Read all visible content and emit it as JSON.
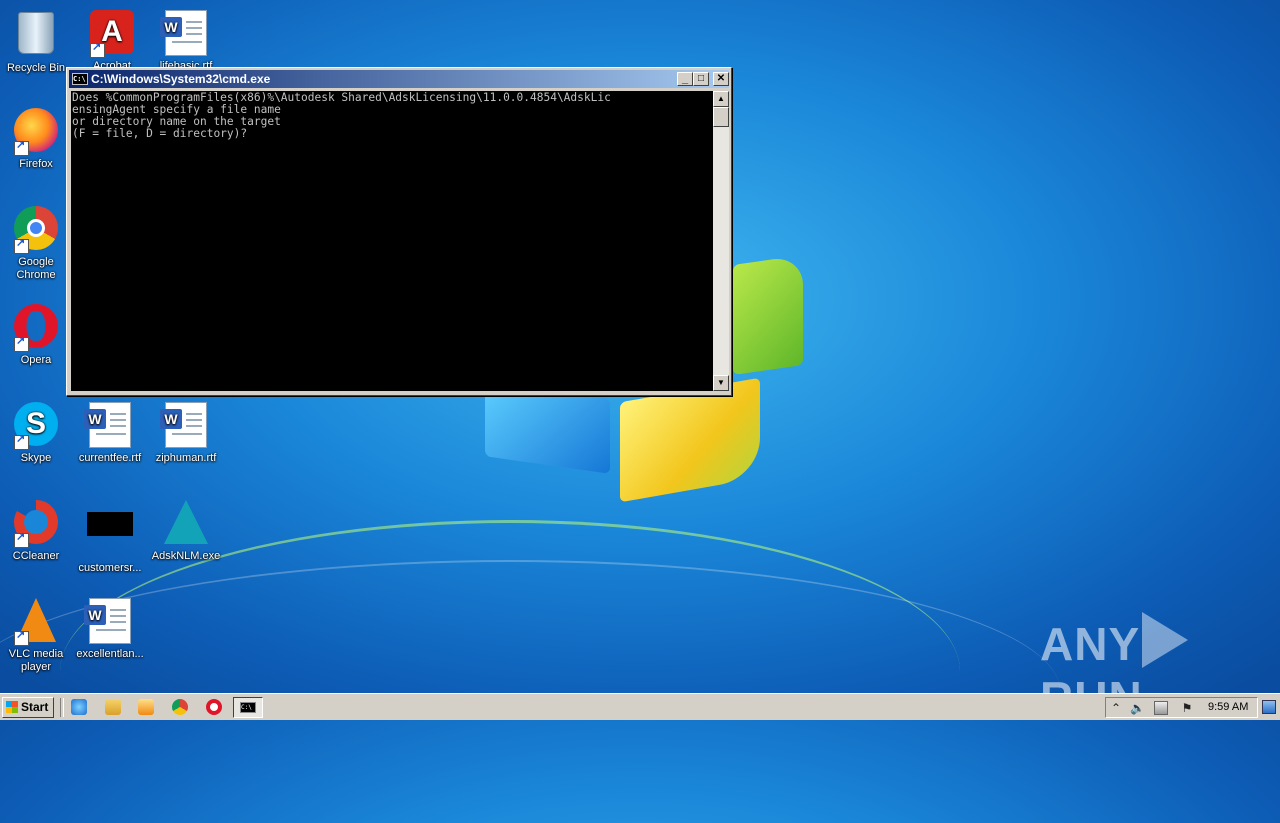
{
  "desktop": {
    "icons": [
      {
        "label": "Recycle Bin",
        "icon": "recycle-bin-icon"
      },
      {
        "label": "Acrobat",
        "icon": "acrobat-icon"
      },
      {
        "label": "lifebasic.rtf",
        "icon": "word-document-icon"
      },
      {
        "label": "Firefox",
        "icon": "firefox-icon"
      },
      {
        "label": "Google Chrome",
        "icon": "chrome-icon"
      },
      {
        "label": "Opera",
        "icon": "opera-icon"
      },
      {
        "label": "Skype",
        "icon": "skype-icon"
      },
      {
        "label": "currentfee.rtf",
        "icon": "word-document-icon"
      },
      {
        "label": "ziphuman.rtf",
        "icon": "word-document-icon"
      },
      {
        "label": "CCleaner",
        "icon": "ccleaner-icon"
      },
      {
        "label": "customersr...",
        "icon": "black-thumbnail-icon"
      },
      {
        "label": "AdskNLM.exe",
        "icon": "autodesk-icon"
      },
      {
        "label": "VLC media player",
        "icon": "vlc-icon"
      },
      {
        "label": "excellentlan...",
        "icon": "word-document-icon"
      }
    ]
  },
  "cmd_window": {
    "title": "C:\\Windows\\System32\\cmd.exe",
    "console_text": "Does %CommonProgramFiles(x86)%\\Autodesk Shared\\AdskLicensing\\11.0.0.4854\\AdskLic\nensingAgent specify a file name\nor directory name on the target\n(F = file, D = directory)?",
    "minimize": "_",
    "maximize": "□",
    "close": "✕"
  },
  "taskbar": {
    "start_label": "Start",
    "clock": "9:59 AM"
  },
  "watermark": {
    "left": "ANY",
    "right": "RUN"
  },
  "colors": {
    "console_bg": "#000000",
    "console_fg": "#c0c0c0",
    "titlebar_start": "#0a246a",
    "titlebar_end": "#a6caf0"
  }
}
